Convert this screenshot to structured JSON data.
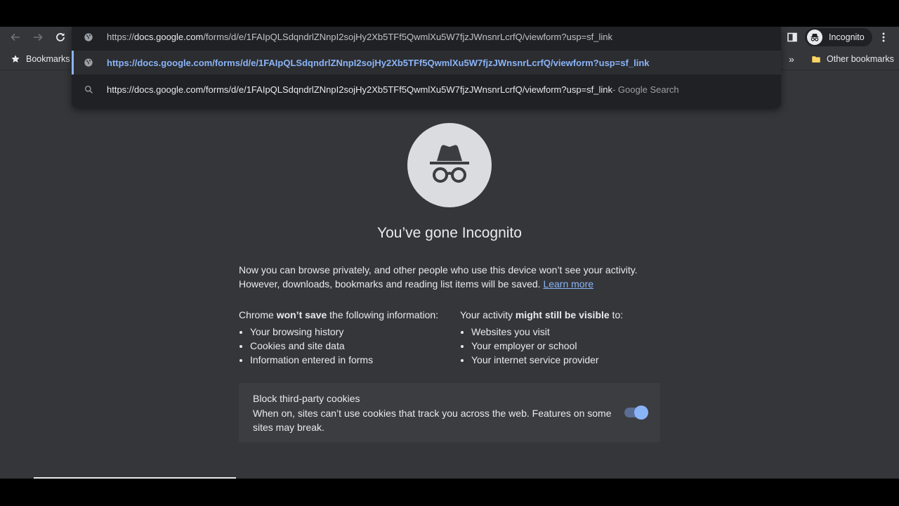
{
  "omnibox": {
    "input_prefix": "https://",
    "input_host": "docs.google.com",
    "input_path": "/forms/d/e/1FAIpQLSdqndrlZNnpI2sojHy2Xb5TFf5QwmlXu5W7fjzJWnsnrLcrfQ/viewform?usp=sf_link",
    "suggestions": [
      {
        "text": "https://docs.google.com/forms/d/e/1FAIpQLSdqndrlZNnpI2sojHy2Xb5TFf5QwmlXu5W7fjzJWnsnrLcrfQ/viewform?usp=sf_link",
        "icon": "globe-icon"
      },
      {
        "text": "https://docs.google.com/forms/d/e/1FAIpQLSdqndrlZNnpI2sojHy2Xb5TFf5QwmlXu5W7fjzJWnsnrLcrfQ/viewform?usp=sf_link",
        "suffix": " - Google Search",
        "icon": "search-icon"
      }
    ]
  },
  "toolbar": {
    "profile_label": "Incognito"
  },
  "bookmarks": {
    "left_label": "Bookmarks",
    "overflow": "»",
    "other_label": "Other bookmarks"
  },
  "ntp": {
    "title": "You’ve gone Incognito",
    "intro_text": "Now you can browse privately, and other people who use this device won’t see your activity. However, downloads, bookmarks and reading list items will be saved. ",
    "learn_more": "Learn more",
    "left_col": {
      "head_pre": "Chrome ",
      "head_bold": "won’t save",
      "head_post": " the following information:",
      "items": [
        "Your browsing history",
        "Cookies and site data",
        "Information entered in forms"
      ]
    },
    "right_col": {
      "head_pre": "Your activity ",
      "head_bold": "might still be visible",
      "head_post": " to:",
      "items": [
        "Websites you visit",
        "Your employer or school",
        "Your internet service provider"
      ]
    },
    "cookies": {
      "title": "Block third-party cookies",
      "description": "When on, sites can’t use cookies that track you across the web. Features on some sites may break.",
      "enabled": true
    }
  },
  "colors": {
    "accent": "#8ab4f8",
    "background": "#35363a",
    "dropdown": "#202124"
  }
}
